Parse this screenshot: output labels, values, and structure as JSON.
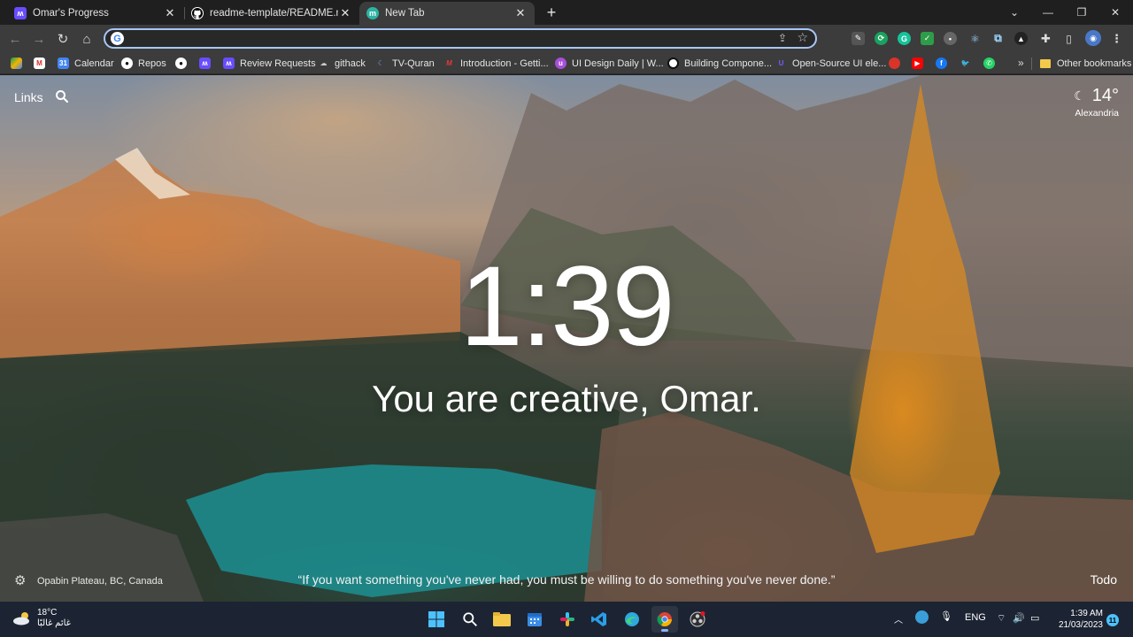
{
  "tabs": [
    {
      "label": "Omar's Progress",
      "favicon": "momentum-icon",
      "color": "#6a4cff"
    },
    {
      "label": "readme-template/README.md a",
      "favicon": "github-icon",
      "color": "#000000"
    },
    {
      "label": "New Tab",
      "favicon": "momentum-m-icon",
      "color": "#2bb3a3"
    }
  ],
  "toolbar": {
    "address_value": "",
    "address_placeholder": ""
  },
  "bookmarks": [
    {
      "label": "",
      "icon": "google-drive-icon"
    },
    {
      "label": "",
      "icon": "gmail-icon"
    },
    {
      "label": "Calendar",
      "icon": "calendar-icon"
    },
    {
      "label": "Repos",
      "icon": "github-icon"
    },
    {
      "label": "",
      "icon": "github-icon"
    },
    {
      "label": "",
      "icon": "momentum-icon"
    },
    {
      "label": "Review Requests",
      "icon": "momentum-icon"
    },
    {
      "label": "githack",
      "icon": "githack-icon"
    },
    {
      "label": "TV-Quran",
      "icon": "tv-quran-icon"
    },
    {
      "label": "Introduction - Getti...",
      "icon": "m-icon"
    },
    {
      "label": "UI Design Daily | W...",
      "icon": "ui-icon"
    },
    {
      "label": "Building Compone...",
      "icon": "circle-icon"
    },
    {
      "label": "Open-Source UI ele...",
      "icon": "ui-lib-icon"
    },
    {
      "label": "",
      "icon": "red-icon"
    },
    {
      "label": "",
      "icon": "youtube-icon"
    },
    {
      "label": "",
      "icon": "facebook-icon"
    },
    {
      "label": "",
      "icon": "twitter-icon"
    },
    {
      "label": "",
      "icon": "whatsapp-icon"
    }
  ],
  "bookmarks_more": "»",
  "other_bookmarks": "Other bookmarks",
  "newtab": {
    "links": "Links",
    "temperature": "14°",
    "city": "Alexandria",
    "time": "1:39",
    "greeting": "You are creative, Omar.",
    "photo_location": "Opabin Plateau, BC, Canada",
    "quote": "“If you want something you've never had, you must be willing to do something you've never done.”",
    "todo": "Todo"
  },
  "taskbar": {
    "weather_temp": "18°C",
    "weather_text": "غائم غالبًا",
    "language": "ENG",
    "time": "1:39 AM",
    "date": "21/03/2023",
    "notifications": "11"
  }
}
